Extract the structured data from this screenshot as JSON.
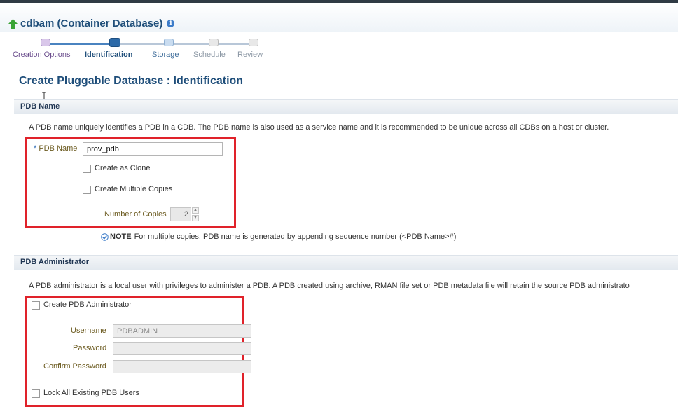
{
  "header": {
    "title": "cdbam (Container Database)",
    "icons": {
      "back": "up-arrow-icon",
      "info": "info-icon"
    },
    "info_glyph": "i"
  },
  "train": {
    "steps": [
      {
        "label": "Creation Options",
        "state": "visited"
      },
      {
        "label": "Identification",
        "state": "current"
      },
      {
        "label": "Storage",
        "state": "next"
      },
      {
        "label": "Schedule",
        "state": "future"
      },
      {
        "label": "Review",
        "state": "future"
      }
    ]
  },
  "page": {
    "title": "Create Pluggable Database : Identification"
  },
  "pdb_name_section": {
    "heading": "PDB Name",
    "description": "A PDB name uniquely identifies a PDB in a CDB. The PDB name is also used as a service name and it is recommended to be unique across all CDBs on a host or cluster.",
    "field_label": "PDB Name",
    "required_marker": "*",
    "field_value": "prov_pdb",
    "create_as_clone_label": "Create as Clone",
    "create_as_clone_checked": false,
    "create_multiple_copies_label": "Create Multiple Copies",
    "create_multiple_copies_checked": false,
    "number_of_copies_label": "Number of Copies",
    "number_of_copies_value": "2",
    "note_label": "NOTE",
    "note_text": "For multiple copies, PDB name is generated by appending sequence number (<PDB Name>#)"
  },
  "pdb_admin_section": {
    "heading": "PDB Administrator",
    "description": "A PDB administrator is a local user with privileges to administer a PDB. A PDB created using archive, RMAN file set or PDB metadata file will retain the source PDB administrato",
    "create_admin_label": "Create PDB Administrator",
    "create_admin_checked": false,
    "username_label": "Username",
    "username_placeholder": "PDBADMIN",
    "password_label": "Password",
    "password_value": "",
    "confirm_password_label": "Confirm Password",
    "confirm_password_value": "",
    "lock_users_label": "Lock All Existing PDB Users",
    "lock_users_checked": false
  },
  "colors": {
    "title_blue": "#1f4e7a",
    "highlight_red": "#e0222a",
    "label_olive": "#6b5a1f",
    "train_current": "#2d6aa8"
  }
}
